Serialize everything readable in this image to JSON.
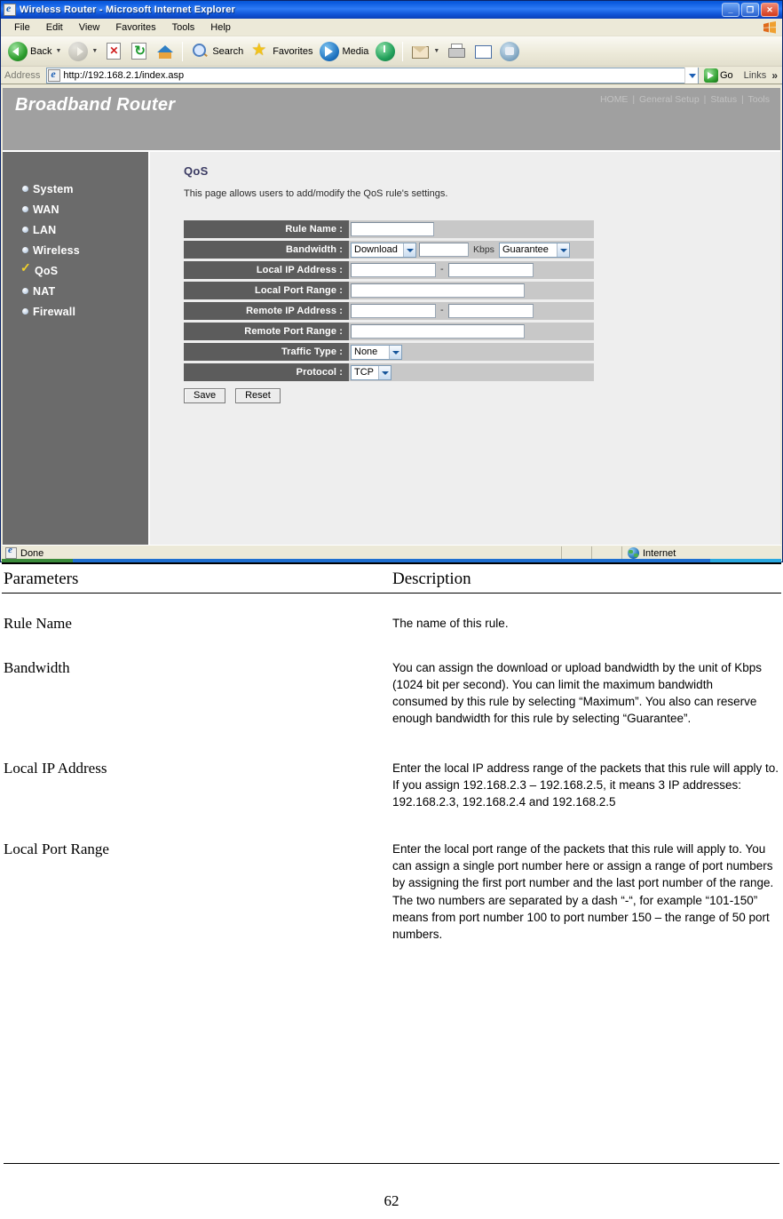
{
  "browser": {
    "title": "Wireless Router - Microsoft Internet Explorer",
    "window_buttons": {
      "minimize": "_",
      "maximize": "❐",
      "close": "✕"
    },
    "menu": [
      "File",
      "Edit",
      "View",
      "Favorites",
      "Tools",
      "Help"
    ],
    "toolbar": {
      "back_label": "Back",
      "search_label": "Search",
      "favorites_label": "Favorites",
      "media_label": "Media",
      "icons": [
        "back-icon",
        "forward-icon",
        "stop-icon",
        "refresh-icon",
        "home-icon",
        "search-icon",
        "favorites-star-icon",
        "media-icon",
        "history-icon",
        "mail-icon",
        "print-icon",
        "edit-icon",
        "messenger-icon"
      ]
    },
    "address": {
      "label": "Address",
      "url": "http://192.168.2.1/index.asp",
      "go_label": "Go",
      "links_label": "Links",
      "chevron": "»"
    },
    "status": {
      "text": "Done",
      "zone": "Internet"
    }
  },
  "router": {
    "brand": "Broadband Router",
    "top_nav": [
      "HOME",
      "General Setup",
      "Status",
      "Tools"
    ],
    "nav_separator": "|",
    "sidebar": [
      {
        "label": "System",
        "selected": false
      },
      {
        "label": "WAN",
        "selected": false
      },
      {
        "label": "LAN",
        "selected": false
      },
      {
        "label": "Wireless",
        "selected": false
      },
      {
        "label": "QoS",
        "selected": true
      },
      {
        "label": "NAT",
        "selected": false
      },
      {
        "label": "Firewall",
        "selected": false
      }
    ],
    "page": {
      "title": "QoS",
      "description": "This page allows users to add/modify the QoS rule's settings."
    },
    "form": {
      "rows": [
        {
          "label": "Rule Name :"
        },
        {
          "label": "Bandwidth :"
        },
        {
          "label": "Local IP Address :"
        },
        {
          "label": "Local Port Range :"
        },
        {
          "label": "Remote IP Address :"
        },
        {
          "label": "Remote Port Range :"
        },
        {
          "label": "Traffic Type :"
        },
        {
          "label": "Protocol :"
        }
      ],
      "rule_name_value": "",
      "bandwidth_direction": "Download",
      "bandwidth_value": "",
      "bandwidth_unit": "Kbps",
      "bandwidth_mode": "Guarantee",
      "local_ip_start": "",
      "local_ip_end": "",
      "ip_separator": "-",
      "local_port_range": "",
      "remote_ip_start": "",
      "remote_ip_end": "",
      "remote_port_range": "",
      "traffic_type": "None",
      "protocol": "TCP",
      "save_label": "Save",
      "reset_label": "Reset"
    },
    "colors": {
      "banner": "#a0a0a0",
      "sidebar": "#6b6b6b",
      "label_cell": "#5c5c5c",
      "field_cell": "#c8c8c8",
      "content_bg": "#eeeeee",
      "title": "#3b3b63",
      "check": "#f2d22a"
    }
  },
  "document": {
    "headers": {
      "parameters": "Parameters",
      "description": "Description"
    },
    "rows": [
      {
        "parameter": "Rule Name",
        "description": "The name of this rule."
      },
      {
        "parameter": "Bandwidth",
        "description": "You can assign the download or upload bandwidth by the unit of Kbps (1024 bit per second). You can limit the maximum bandwidth consumed by this rule by selecting “Maximum”. You also can reserve enough bandwidth for this rule by selecting “Guarantee”."
      },
      {
        "parameter": "Local IP Address",
        "description": "Enter the local IP address range of the packets that this rule will apply to. If you assign 192.168.2.3 – 192.168.2.5, it means 3 IP addresses: 192.168.2.3, 192.168.2.4 and 192.168.2.5"
      },
      {
        "parameter": "Local Port Range",
        "description": "Enter the local port range of the packets that this rule will apply to. You can assign a single port number here or assign a range of port numbers by assigning the first port number and the last port number of the range. The two numbers are separated by a dash “-“, for example “101-150” means from port number 100 to port number 150 – the range of 50 port numbers."
      }
    ],
    "page_number": "62"
  }
}
